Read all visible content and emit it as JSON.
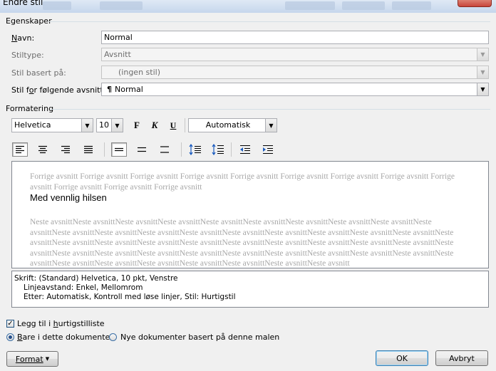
{
  "window": {
    "title": "Endre stil"
  },
  "egenskaper": {
    "group_label": "Egenskaper",
    "navn_label": "Navn:",
    "navn_value": "Normal",
    "stiltype_label": "Stiltype:",
    "stiltype_value": "Avsnitt",
    "basert_label": "Stil basert på:",
    "basert_value": "(ingen stil)",
    "folgende_label": "Stil for følgende avsnitt:",
    "folgende_value": "Normal",
    "pilcrow": "¶"
  },
  "formatering": {
    "group_label": "Formatering",
    "font": "Helvetica",
    "size": "10",
    "bold": "F",
    "italic": "K",
    "underline": "U",
    "color": "Automatisk"
  },
  "preview": {
    "previous_text": "Forrige avsnitt Forrige avsnitt Forrige avsnitt Forrige avsnitt Forrige avsnitt Forrige avsnitt Forrige avsnitt Forrige avsnitt Forrige avsnitt Forrige avsnitt Forrige avsnitt Forrige avsnitt",
    "current_text": "Med vennlig hilsen",
    "next_text": "Neste avsnittNeste avsnittNeste avsnittNeste avsnittNeste avsnittNeste avsnittNeste avsnittNeste avsnittNeste avsnittNeste avsnittNeste avsnittNeste avsnittNeste avsnittNeste avsnittNeste avsnittNeste avsnittNeste avsnittNeste avsnittNeste avsnittNeste avsnittNeste avsnittNeste avsnittNeste avsnittNeste avsnittNeste avsnittNeste avsnittNeste avsnittNeste avsnittNeste avsnittNeste avsnittNeste avsnittNeste avsnittNeste avsnittNeste avsnittNeste avsnittNeste avsnittNeste avsnittNeste avsnittNeste avsnittNeste avsnittNeste avsnittNeste avsnittNeste avsnittNeste avsnittNeste avsnittNeste avsnittNeste avsnitt"
  },
  "description": {
    "line1": "Skrift: (Standard) Helvetica, 10 pkt, Venstre",
    "line2": "Linjeavstand:  Enkel, Mellomrom",
    "line3": "Etter:  Automatisk, Kontroll med løse linjer, Stil: Hurtigstil"
  },
  "options": {
    "add_to_quick_label": "Legg til i hurtigstilliste",
    "add_to_quick_checked": true,
    "only_this_doc_label": "Bare i dette dokumentet",
    "new_docs_label": "Nye dokumenter basert på denne malen",
    "selected": "only_this_doc"
  },
  "buttons": {
    "format": "Format",
    "ok": "OK",
    "cancel": "Avbryt"
  }
}
